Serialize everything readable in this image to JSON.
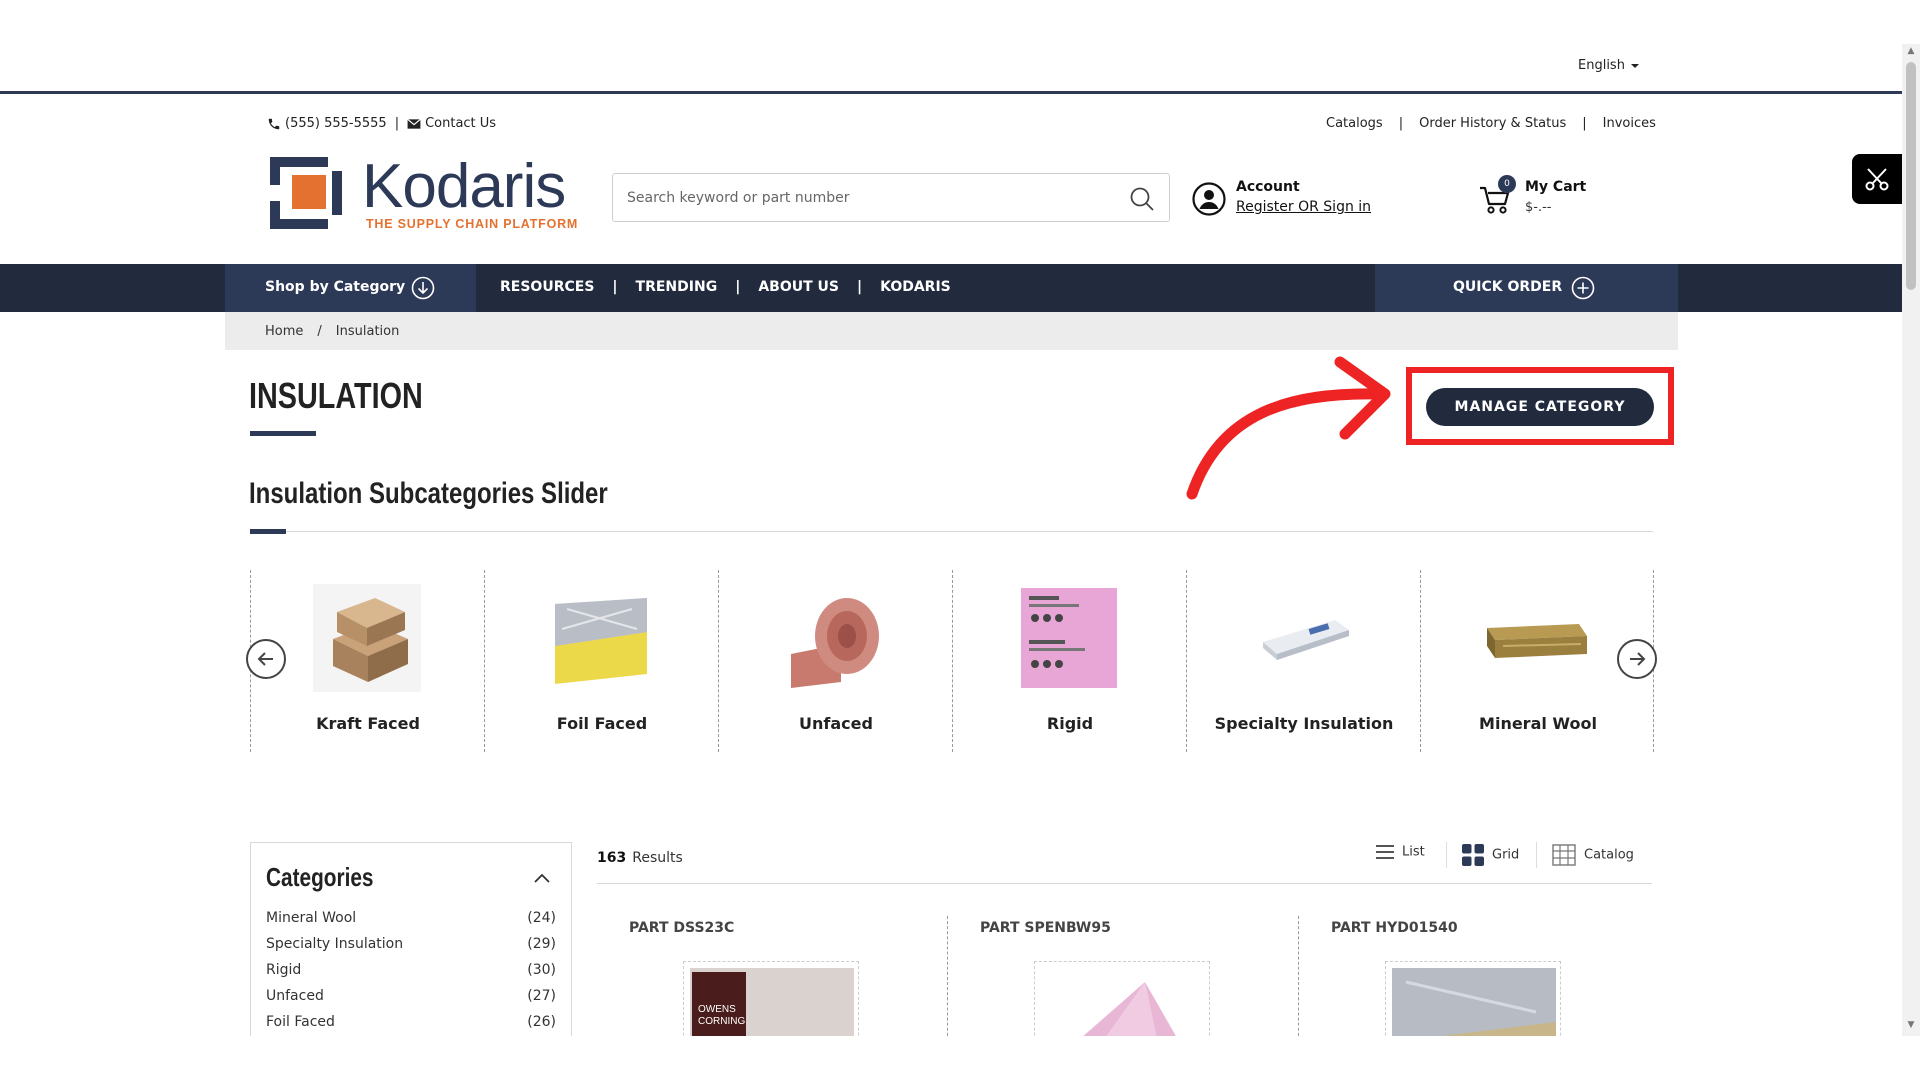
{
  "language": {
    "selected": "English"
  },
  "utility_bar": {
    "phone": "(555) 555-5555",
    "contact": "Contact Us",
    "links": [
      "Catalogs",
      "Order History & Status",
      "Invoices"
    ]
  },
  "logo": {
    "name": "Kodaris",
    "tagline": "THE SUPPLY CHAIN PLATFORM",
    "colors": {
      "navy": "#2d3a57",
      "orange": "#e4712f"
    }
  },
  "search": {
    "placeholder": "Search keyword or part number",
    "value": ""
  },
  "account": {
    "title": "Account",
    "link": "Register OR Sign in"
  },
  "cart": {
    "title": "My Cart",
    "count": "0",
    "total": "$-.--"
  },
  "nav": {
    "shop": "Shop by Category",
    "links": [
      "RESOURCES",
      "TRENDING",
      "ABOUT US",
      "KODARIS"
    ],
    "quick_order": "QUICK ORDER"
  },
  "breadcrumb": {
    "home": "Home",
    "separator": "/",
    "current": "Insulation"
  },
  "page": {
    "title": "INSULATION",
    "manage_button": "MANAGE CATEGORY",
    "highlight_color": "#ee2424"
  },
  "slider": {
    "title": "Insulation Subcategories Slider",
    "items": [
      {
        "label": "Kraft Faced",
        "icon": "kraft-faced-batt-image"
      },
      {
        "label": "Foil Faced",
        "icon": "foil-faced-batt-image"
      },
      {
        "label": "Unfaced",
        "icon": "unfaced-roll-image"
      },
      {
        "label": "Rigid",
        "icon": "rigid-board-image"
      },
      {
        "label": "Specialty Insulation",
        "icon": "specialty-insulation-image"
      },
      {
        "label": "Mineral Wool",
        "icon": "mineral-wool-image"
      }
    ]
  },
  "categories": {
    "title": "Categories",
    "items": [
      {
        "label": "Mineral Wool",
        "count": "(24)"
      },
      {
        "label": "Specialty Insulation",
        "count": "(29)"
      },
      {
        "label": "Rigid",
        "count": "(30)"
      },
      {
        "label": "Unfaced",
        "count": "(27)"
      },
      {
        "label": "Foil Faced",
        "count": "(26)"
      }
    ]
  },
  "results": {
    "count": "163",
    "label": "Results",
    "views": [
      "List",
      "Grid",
      "Catalog"
    ],
    "products": [
      {
        "title": "PART DSS23C"
      },
      {
        "title": "PART SPENBW95"
      },
      {
        "title": "PART HYD01540"
      }
    ]
  }
}
